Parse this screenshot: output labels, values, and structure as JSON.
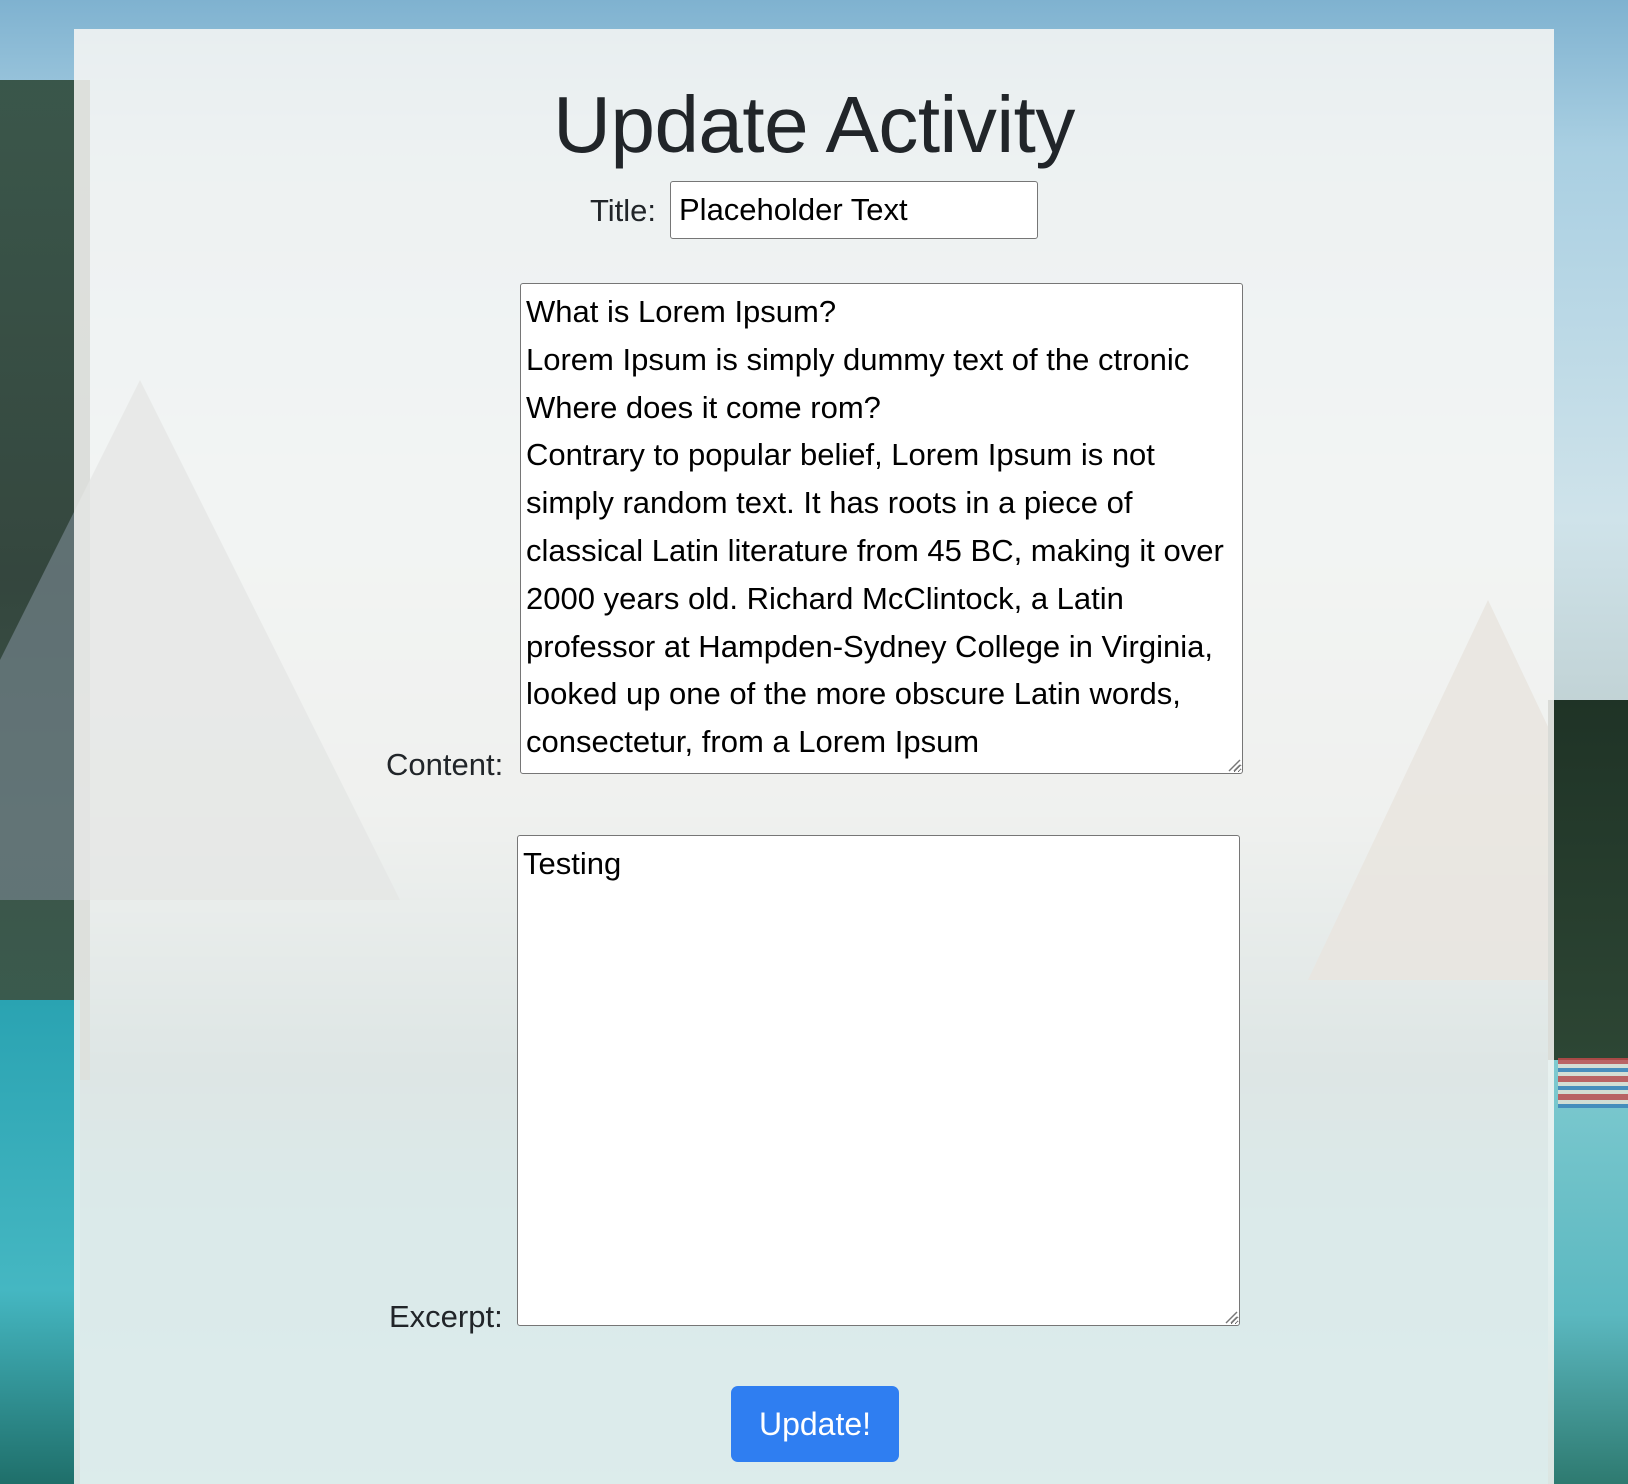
{
  "page": {
    "title": "Update Activity"
  },
  "form": {
    "title_label": "Title:",
    "title_value": "Placeholder Text",
    "content_label": "Content:",
    "content_value": "What is Lorem Ipsum?\nLorem Ipsum is simply dummy text of the ctronic\nWhere does it come rom?\nContrary to popular belief, Lorem Ipsum is not simply random text. It has roots in a piece of classical Latin literature from 45 BC, making it over 2000 years old. Richard McClintock, a Latin professor at Hampden-Sydney College in Virginia, looked up one of the more obscure Latin words, consectetur, from a Lorem Ipsum",
    "excerpt_label": "Excerpt:",
    "excerpt_value": "Testing",
    "submit_label": "Update!"
  },
  "colors": {
    "button_bg": "#2f7ef1",
    "button_text": "#ffffff",
    "panel_bg": "#f8f7f4",
    "heading_text": "#212529"
  }
}
